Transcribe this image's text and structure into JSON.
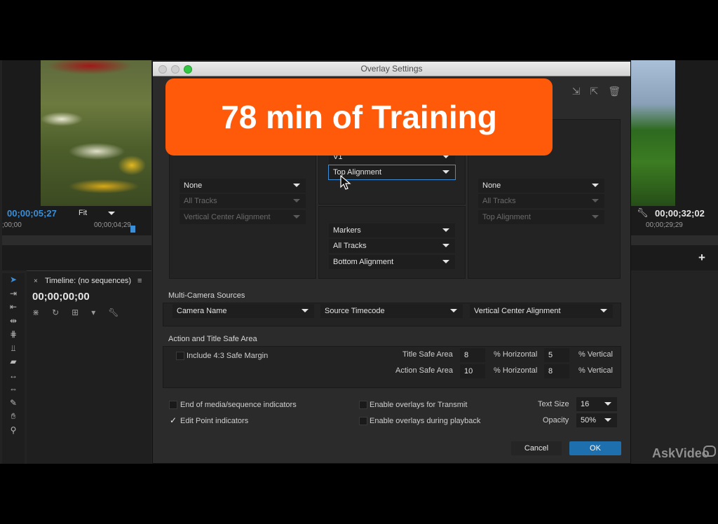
{
  "app": {
    "source_timecode": "00;00;05;27",
    "fit_label": "Fit",
    "source_ruler_start": ";00;00",
    "source_ruler_mid": "00;00;04;29",
    "program_timecode": "00;00;32;02",
    "program_ruler": "00;00;29;29"
  },
  "timeline": {
    "title": "Timeline: (no sequences)",
    "timecode": "00;00;00;00"
  },
  "dialog": {
    "title": "Overlay Settings",
    "left_group": {
      "dd1": "None",
      "dd2": "All Tracks",
      "dd3": "Vertical Center Alignment"
    },
    "center_group": {
      "dd0": "V1",
      "dd1": "Top Alignment",
      "dd2": "Markers",
      "dd3": "All Tracks",
      "dd4": "Bottom Alignment"
    },
    "right_group": {
      "dd1": "None",
      "dd2": "All Tracks",
      "dd3": "Top Alignment"
    },
    "multicam": {
      "title": "Multi-Camera Sources",
      "dd1": "Camera Name",
      "dd2": "Source Timecode",
      "dd3": "Vertical Center Alignment"
    },
    "safe": {
      "title": "Action and Title Safe Area",
      "include_label": "Include 4:3 Safe Margin",
      "title_safe_label": "Title Safe Area",
      "title_h": "8",
      "title_v": "5",
      "action_safe_label": "Action Safe Area",
      "action_h": "10",
      "action_v": "8",
      "horizontal_label": "% Horizontal",
      "vertical_label": "% Vertical"
    },
    "options": {
      "end_media": "End of media/sequence indicators",
      "edit_point": "Edit Point indicators",
      "edit_point_checked": "✓",
      "transmit": "Enable overlays for Transmit",
      "playback": "Enable overlays during playback",
      "text_size_label": "Text Size",
      "text_size_value": "16",
      "opacity_label": "Opacity",
      "opacity_value": "50%"
    },
    "cancel_label": "Cancel",
    "ok_label": "OK"
  },
  "banner": {
    "text": "78 min of Training"
  },
  "watermark": {
    "text": "AskVideo"
  }
}
